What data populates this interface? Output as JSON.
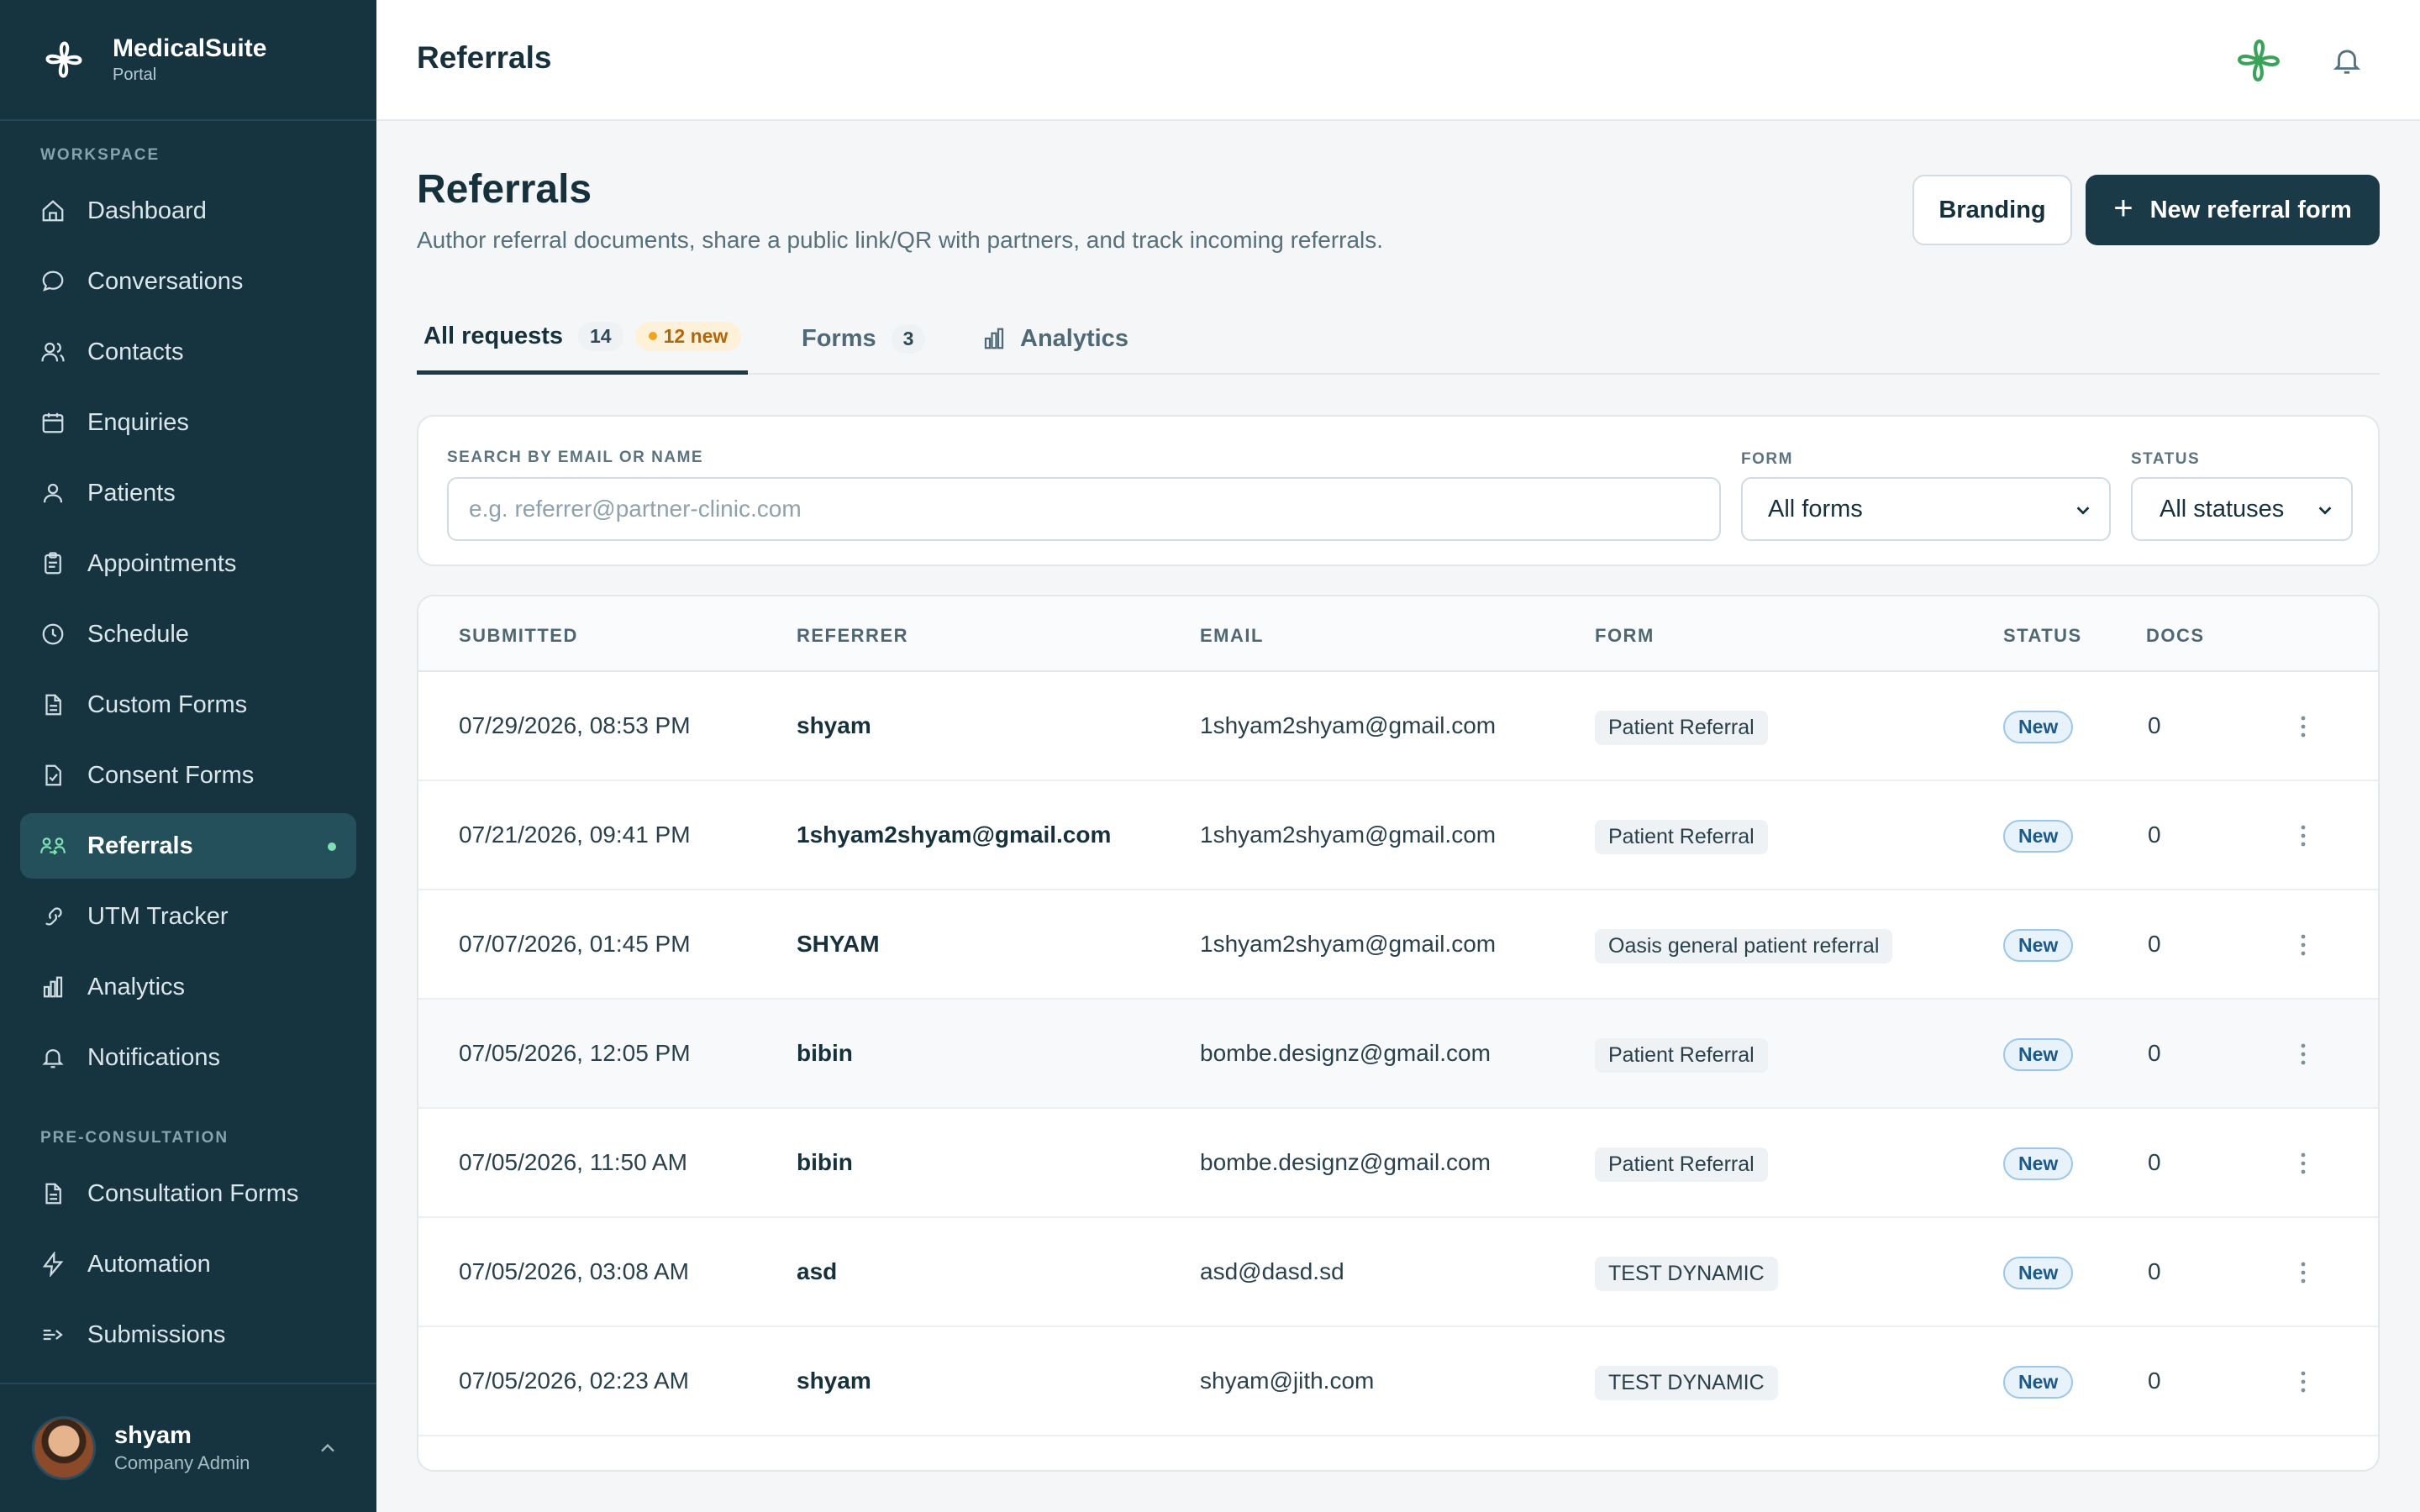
{
  "sidebar": {
    "brand_name": "MedicalSuite",
    "brand_sub": "Portal",
    "workspace_label": "WORKSPACE",
    "items": [
      {
        "label": "Dashboard",
        "icon": "home-icon"
      },
      {
        "label": "Conversations",
        "icon": "chat-icon"
      },
      {
        "label": "Contacts",
        "icon": "contacts-icon"
      },
      {
        "label": "Enquiries",
        "icon": "calendar-icon"
      },
      {
        "label": "Patients",
        "icon": "user-icon"
      },
      {
        "label": "Appointments",
        "icon": "clipboard-icon"
      },
      {
        "label": "Schedule",
        "icon": "clock-icon"
      },
      {
        "label": "Custom Forms",
        "icon": "document-icon"
      },
      {
        "label": "Consent Forms",
        "icon": "consent-document-icon"
      },
      {
        "label": "Referrals",
        "icon": "referrals-icon",
        "active": true
      },
      {
        "label": "UTM Tracker",
        "icon": "link-icon"
      },
      {
        "label": "Analytics",
        "icon": "bar-chart-icon"
      },
      {
        "label": "Notifications",
        "icon": "bell-icon"
      }
    ],
    "preconsult_label": "PRE-CONSULTATION",
    "preconsult_items": [
      {
        "label": "Consultation Forms",
        "icon": "document-icon"
      },
      {
        "label": "Automation",
        "icon": "lightning-icon"
      },
      {
        "label": "Submissions",
        "icon": "submissions-icon"
      }
    ],
    "user": {
      "name": "shyam",
      "role": "Company Admin"
    }
  },
  "header": {
    "title": "Referrals"
  },
  "main": {
    "title": "Referrals",
    "subtitle": "Author referral documents, share a public link/QR with partners, and track incoming referrals.",
    "branding_label": "Branding",
    "new_form_label": "New referral form",
    "tabs": [
      {
        "label": "All requests",
        "count": "14",
        "new_badge": "12 new"
      },
      {
        "label": "Forms",
        "count": "3"
      },
      {
        "label": "Analytics"
      }
    ]
  },
  "filters": {
    "search_label": "SEARCH BY EMAIL OR NAME",
    "search_placeholder": "e.g. referrer@partner-clinic.com",
    "form_label": "FORM",
    "form_value": "All forms",
    "status_label": "STATUS",
    "status_value": "All statuses"
  },
  "table": {
    "columns": [
      "SUBMITTED",
      "REFERRER",
      "EMAIL",
      "FORM",
      "STATUS",
      "DOCS"
    ],
    "rows": [
      {
        "submitted": "07/29/2026, 08:53 PM",
        "referrer": "shyam",
        "email": "1shyam2shyam@gmail.com",
        "form": "Patient Referral",
        "status": "New",
        "docs": "0"
      },
      {
        "submitted": "07/21/2026, 09:41 PM",
        "referrer": "1shyam2shyam@gmail.com",
        "email": "1shyam2shyam@gmail.com",
        "form": "Patient Referral",
        "status": "New",
        "docs": "0"
      },
      {
        "submitted": "07/07/2026, 01:45 PM",
        "referrer": "SHYAM",
        "email": "1shyam2shyam@gmail.com",
        "form": "Oasis general patient referral",
        "status": "New",
        "docs": "0"
      },
      {
        "submitted": "07/05/2026, 12:05 PM",
        "referrer": "bibin",
        "email": "bombe.designz@gmail.com",
        "form": "Patient Referral",
        "status": "New",
        "docs": "0"
      },
      {
        "submitted": "07/05/2026, 11:50 AM",
        "referrer": "bibin",
        "email": "bombe.designz@gmail.com",
        "form": "Patient Referral",
        "status": "New",
        "docs": "0"
      },
      {
        "submitted": "07/05/2026, 03:08 AM",
        "referrer": "asd",
        "email": "asd@dasd.sd",
        "form": "TEST DYNAMIC",
        "status": "New",
        "docs": "0"
      },
      {
        "submitted": "07/05/2026, 02:23 AM",
        "referrer": "shyam",
        "email": "shyam@jith.com",
        "form": "TEST DYNAMIC",
        "status": "New",
        "docs": "0"
      }
    ]
  },
  "colors": {
    "sidebar_bg": "#163440",
    "accent": "#1b3a48",
    "active_dot": "#7fe0b4",
    "logo_green": "#3aa35a",
    "new_badge": "#b2660a"
  }
}
